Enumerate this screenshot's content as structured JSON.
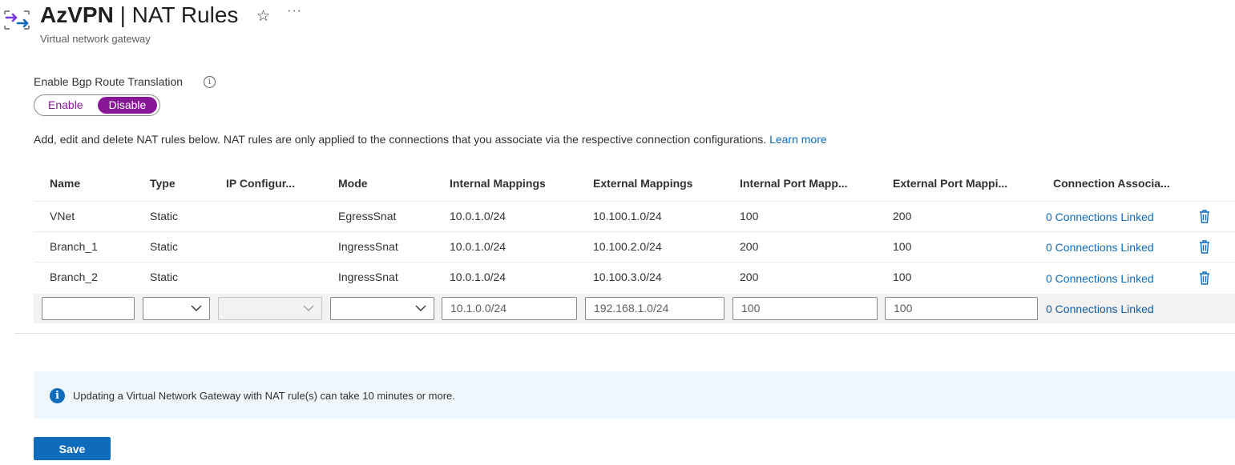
{
  "header": {
    "resource_name": "AzVPN",
    "separator": " | ",
    "page_name": "NAT Rules",
    "subtitle": "Virtual network gateway",
    "favorite_icon": "star-icon",
    "more_icon": "ellipsis-icon"
  },
  "bgp": {
    "label": "Enable Bgp Route Translation",
    "info_icon": "info-icon",
    "enable_label": "Enable",
    "disable_label": "Disable",
    "selected": "Disable"
  },
  "description": {
    "text": "Add, edit and delete NAT rules below. NAT rules are only applied to the connections that you associate via the respective connection configurations.",
    "link": "Learn more"
  },
  "table": {
    "columns": [
      "Name",
      "Type",
      "IP Configur...",
      "Mode",
      "Internal Mappings",
      "External Mappings",
      "Internal Port Mapp...",
      "External Port Mappi...",
      "Connection Associa..."
    ],
    "rows": [
      {
        "name": "VNet",
        "type": "Static",
        "ip_config": "",
        "mode": "EgressSnat",
        "internal": "10.0.1.0/24",
        "external": "10.100.1.0/24",
        "internal_port": "100",
        "external_port": "200",
        "connection": "0 Connections Linked"
      },
      {
        "name": "Branch_1",
        "type": "Static",
        "ip_config": "",
        "mode": "IngressSnat",
        "internal": "10.0.1.0/24",
        "external": "10.100.2.0/24",
        "internal_port": "200",
        "external_port": "100",
        "connection": "0 Connections Linked"
      },
      {
        "name": "Branch_2",
        "type": "Static",
        "ip_config": "",
        "mode": "IngressSnat",
        "internal": "10.0.1.0/24",
        "external": "10.100.3.0/24",
        "internal_port": "200",
        "external_port": "100",
        "connection": "0 Connections Linked"
      }
    ],
    "new_row": {
      "name_value": "",
      "type_value": "",
      "ip_config_value": "",
      "mode_value": "",
      "internal_placeholder": "10.1.0.0/24",
      "external_placeholder": "192.168.1.0/24",
      "internal_port_placeholder": "100",
      "external_port_placeholder": "100",
      "connection": "0 Connections Linked"
    },
    "delete_icon": "trash-icon"
  },
  "banner": {
    "icon": "info-icon",
    "text": "Updating a Virtual Network Gateway with NAT rule(s) can take 10 minutes or more."
  },
  "actions": {
    "save_label": "Save"
  },
  "colors": {
    "accent_blue": "#0f6cbd",
    "toggle_purple": "#881798",
    "banner_bg": "#eff6fc"
  }
}
